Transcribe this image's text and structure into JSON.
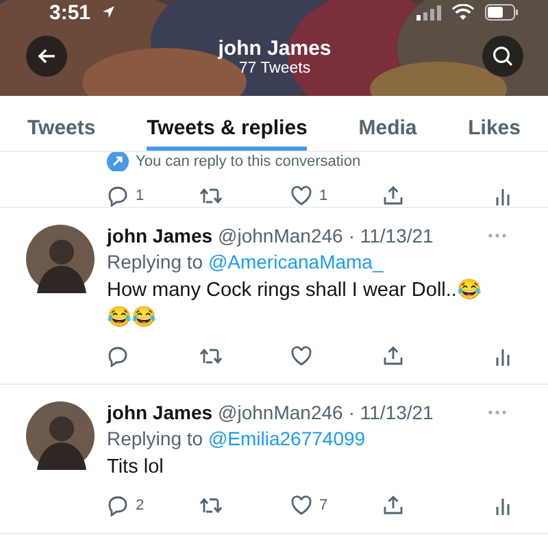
{
  "status_bar": {
    "time": "3:51"
  },
  "header": {
    "title": "john James",
    "subtitle": "77 Tweets"
  },
  "tabs": [
    {
      "label": "Tweets",
      "selected": false
    },
    {
      "label": "Tweets & replies",
      "selected": true
    },
    {
      "label": "Media",
      "selected": false
    },
    {
      "label": "Likes",
      "selected": false
    }
  ],
  "previous_tweet": {
    "note": "You can reply to this conversation",
    "actions": {
      "replies": "1",
      "likes": "1"
    }
  },
  "tweets": [
    {
      "name": "john James",
      "handle": "@johnMan246",
      "date": "· 11/13/21",
      "replying_label": "Replying to",
      "replying_to": "@AmericanaMama_",
      "text": "How many Cock rings shall I wear Doll..😂 😂😂"
    },
    {
      "name": "john James",
      "handle": "@johnMan246",
      "date": "· 11/13/21",
      "replying_label": "Replying to",
      "replying_to": "@Emilia26774099",
      "text": "Tits lol",
      "actions": {
        "replies": "2",
        "likes": "7"
      }
    }
  ]
}
